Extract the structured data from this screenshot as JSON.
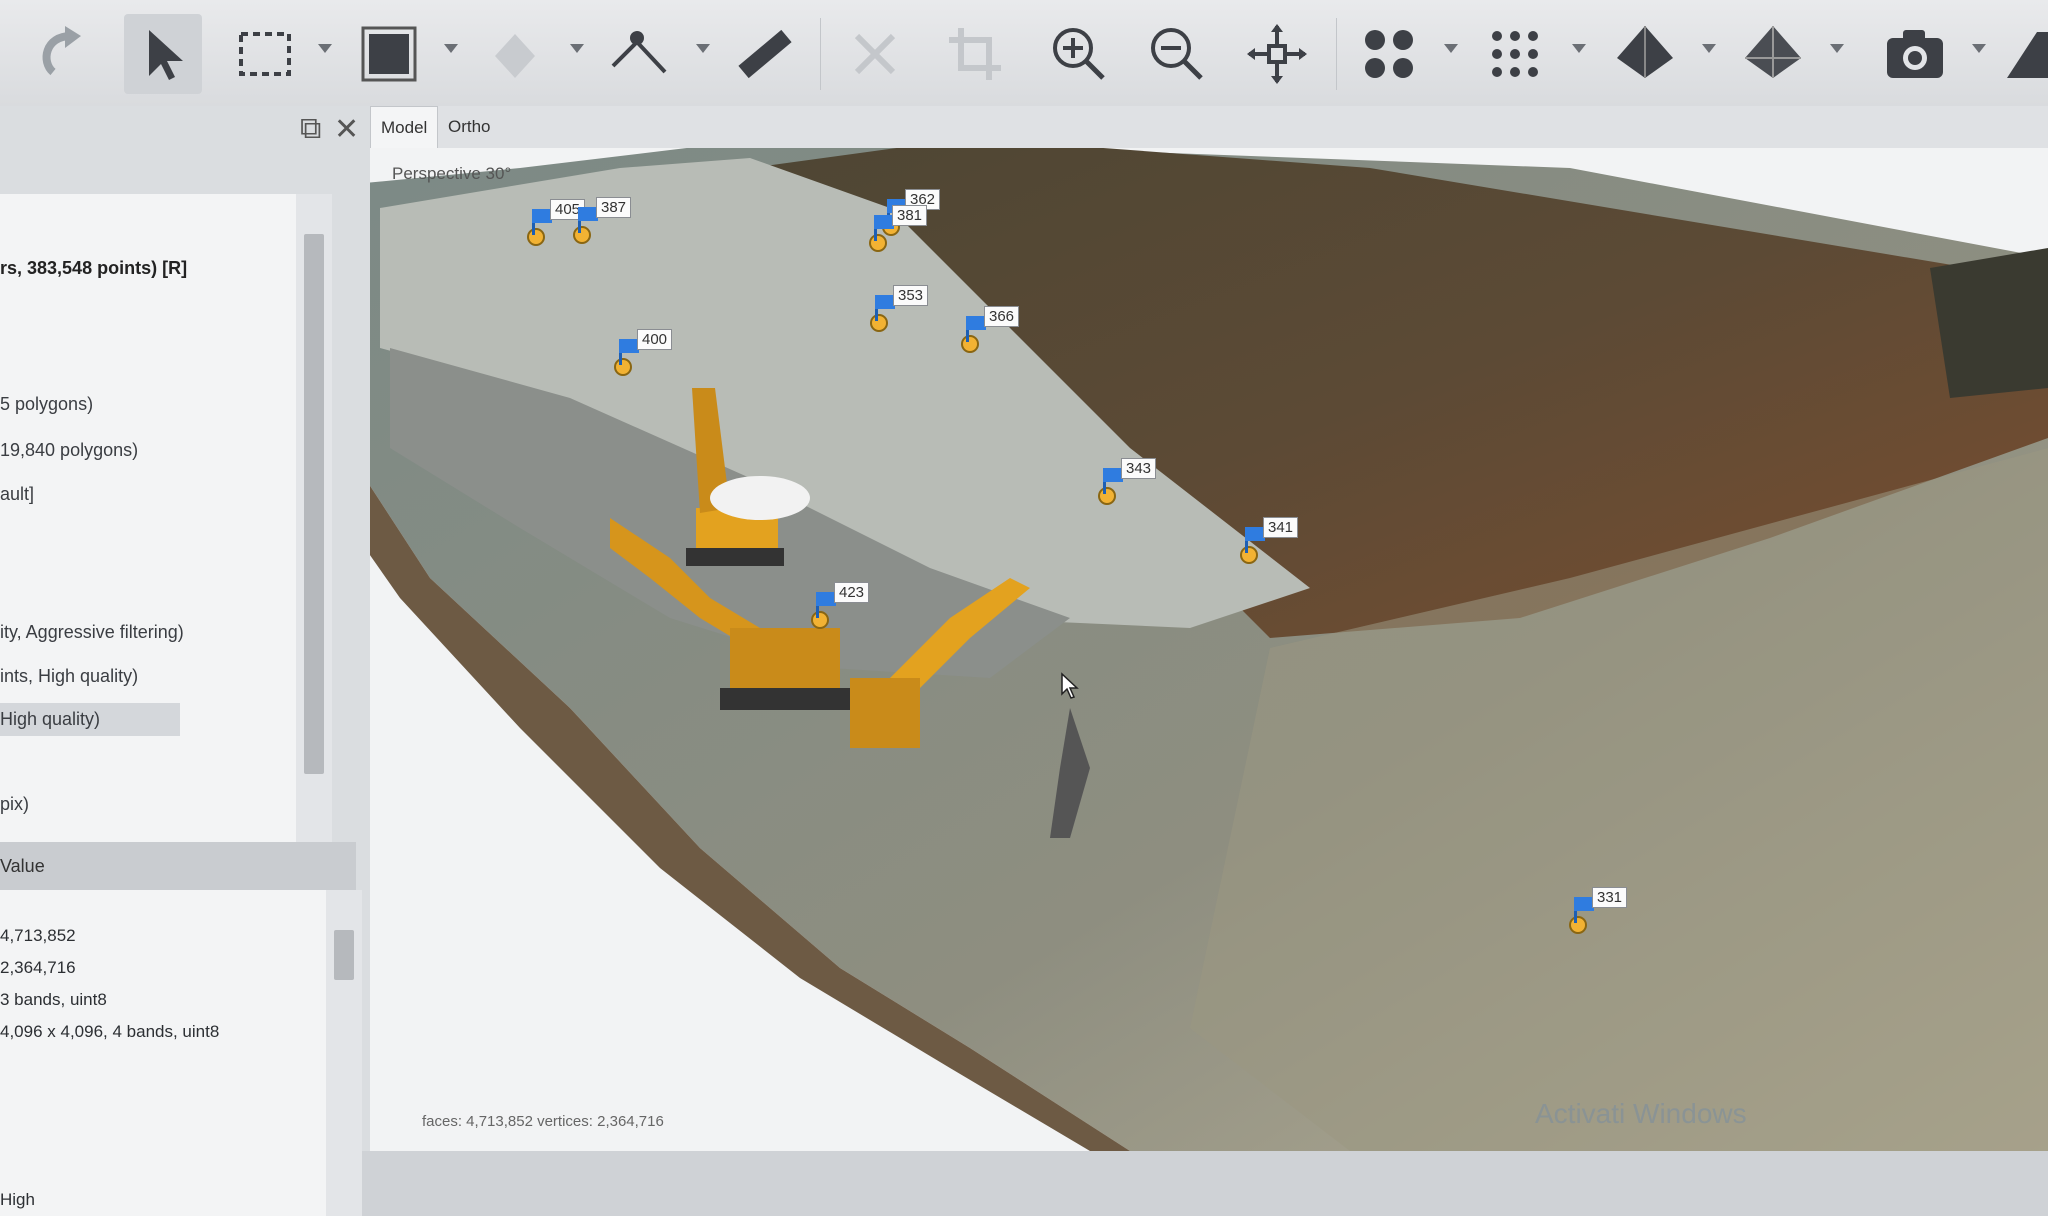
{
  "toolbar": {
    "icons": [
      "redo-icon",
      "select-arrow-icon",
      "rectangle-select-icon",
      "solid-shape-icon",
      "fill-icon",
      "polyline-icon",
      "ruler-icon",
      "delete-icon",
      "crop-icon",
      "zoom-in-icon",
      "zoom-out-icon",
      "move-icon",
      "dots-large-icon",
      "dots-small-icon",
      "pyramid-solid-icon",
      "pyramid-outline-icon",
      "camera-icon",
      "more-icon"
    ]
  },
  "tree": {
    "items": [
      "rs, 383,548 points) [R]",
      "5 polygons)",
      "19,840 polygons)",
      "ault]",
      "ity, Aggressive filtering)",
      "ints, High quality)",
      "High quality)",
      "pix)"
    ]
  },
  "props": {
    "header": "Value",
    "values": [
      "4,713,852",
      "2,364,716",
      "3 bands, uint8",
      "4,096 x 4,096, 4 bands, uint8",
      "High"
    ]
  },
  "tabs": [
    "Model",
    "Ortho"
  ],
  "viewport": {
    "perspective": "Perspective 30°",
    "footer": "faces: 4,713,852 vertices: 2,364,716",
    "watermark": "Activati Windows"
  },
  "markers": {
    "m405": "405",
    "m387": "387",
    "m362": "362",
    "m381": "381",
    "m353": "353",
    "m366": "366",
    "m400": "400",
    "m343": "343",
    "m341": "341",
    "m423": "423",
    "m331": "331"
  },
  "colors": {
    "marker_flag": "#2f7ce0",
    "marker_dot": "#f2b233",
    "excavator": "#e3a21f"
  }
}
